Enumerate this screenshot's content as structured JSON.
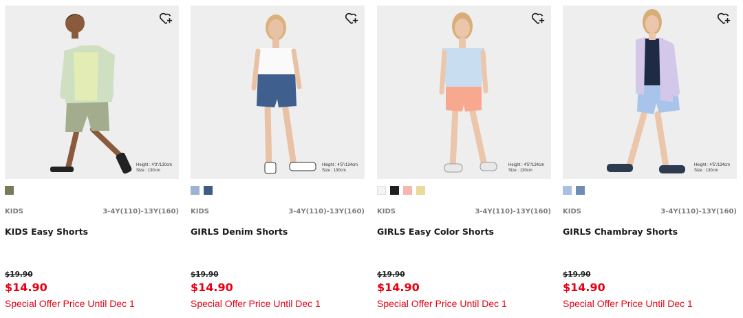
{
  "products": [
    {
      "category": "KIDS",
      "size_range": "3-4Y(110)-13Y(160)",
      "name": "KIDS Easy Shorts",
      "original_price": "$19.90",
      "sale_price": "$14.90",
      "promo": "Special Offer Price Until Dec 1",
      "model_note_1": "Height : 4'3\"/130cm",
      "model_note_2": "Size : 130cm",
      "swatches": [
        "#7a7a5a"
      ],
      "shirt_color": "#e3ecb5",
      "jacket_color": "#cfe0c2",
      "shorts_color": "#a3ad8e",
      "skin_color": "#8b5a3c",
      "shoe_color": "#222222"
    },
    {
      "category": "KIDS",
      "size_range": "3-4Y(110)-13Y(160)",
      "name": "GIRLS Denim Shorts",
      "original_price": "$19.90",
      "sale_price": "$14.90",
      "promo": "Special Offer Price Until Dec 1",
      "model_note_1": "Height : 4'5\"/134cm",
      "model_note_2": "Size : 130cm",
      "swatches": [
        "#9db3d2",
        "#3d5c86"
      ],
      "shirt_color": "#fafafa",
      "jacket_color": "",
      "shorts_color": "#3f5f8e",
      "skin_color": "#e9c2a6",
      "shoe_color": "#ffffff"
    },
    {
      "category": "KIDS",
      "size_range": "3-4Y(110)-13Y(160)",
      "name": "GIRLS Easy Color Shorts",
      "original_price": "$19.90",
      "sale_price": "$14.90",
      "promo": "Special Offer Price Until Dec 1",
      "model_note_1": "Height : 4'5\"/134cm",
      "model_note_2": "Size : 130cm",
      "swatches": [
        "#f4f4f4",
        "#1f1f1f",
        "#f7b7ab",
        "#ecd99a"
      ],
      "shirt_color": "#c8def0",
      "jacket_color": "",
      "shorts_color": "#f8a88e",
      "skin_color": "#ecc6ab",
      "shoe_color": "#e8e8e8"
    },
    {
      "category": "KIDS",
      "size_range": "3-4Y(110)-13Y(160)",
      "name": "GIRLS Chambray Shorts",
      "original_price": "$19.90",
      "sale_price": "$14.90",
      "promo": "Special Offer Price Until Dec 1",
      "model_note_1": "Height : 4'5\"/134cm",
      "model_note_2": "Size : 130cm",
      "swatches": [
        "#a9bfe3",
        "#6d8cb8"
      ],
      "shirt_color": "#1f2a44",
      "jacket_color": "#d3c8ea",
      "shorts_color": "#a9c4ea",
      "skin_color": "#ecc6ab",
      "shoe_color": "#2e3a4e"
    }
  ],
  "icons": {
    "wishlist": "heart-plus-icon"
  }
}
